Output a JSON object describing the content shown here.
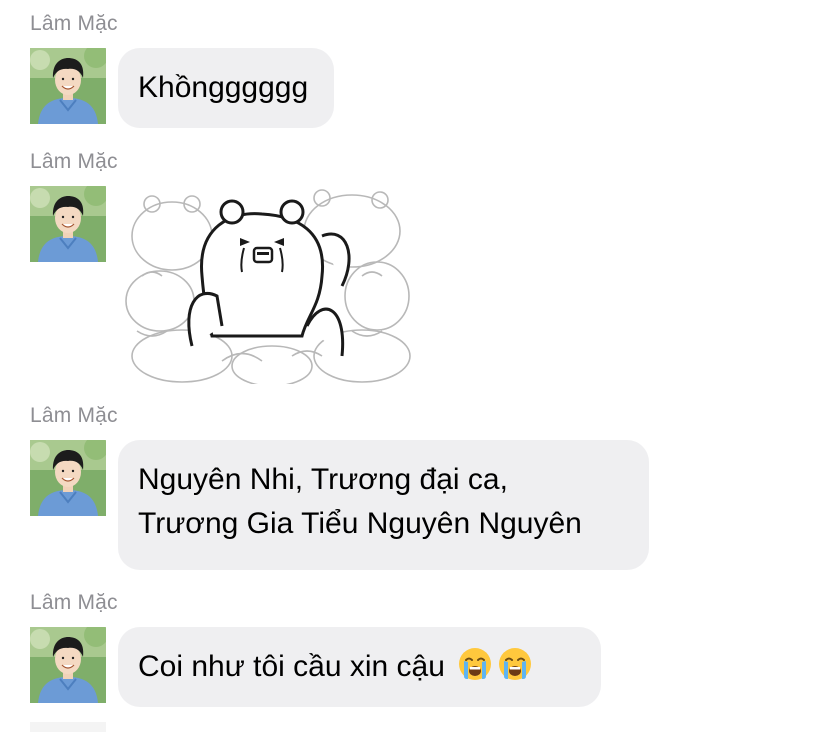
{
  "messages": [
    {
      "sender": "Lâm Mặc",
      "type": "text",
      "lines": [
        "Khồngggggg"
      ]
    },
    {
      "sender": "Lâm Mặc",
      "type": "sticker",
      "sticker_icon": "crying-bear-sticker"
    },
    {
      "sender": "Lâm Mặc",
      "type": "text",
      "lines": [
        "Nguyên Nhi, Trương đại ca,",
        "Trương Gia Tiểu Nguyên Nguyên"
      ]
    },
    {
      "sender": "Lâm Mặc",
      "type": "text",
      "text": "Coi như tôi cầu xin cậu",
      "emojis": [
        "loudly-crying-face-icon",
        "loudly-crying-face-icon"
      ]
    }
  ],
  "colors": {
    "bubble": "#efeff1",
    "sender_name": "#8e8e93",
    "emoji": "#ffc83d",
    "tears": "#5fb4f0"
  }
}
